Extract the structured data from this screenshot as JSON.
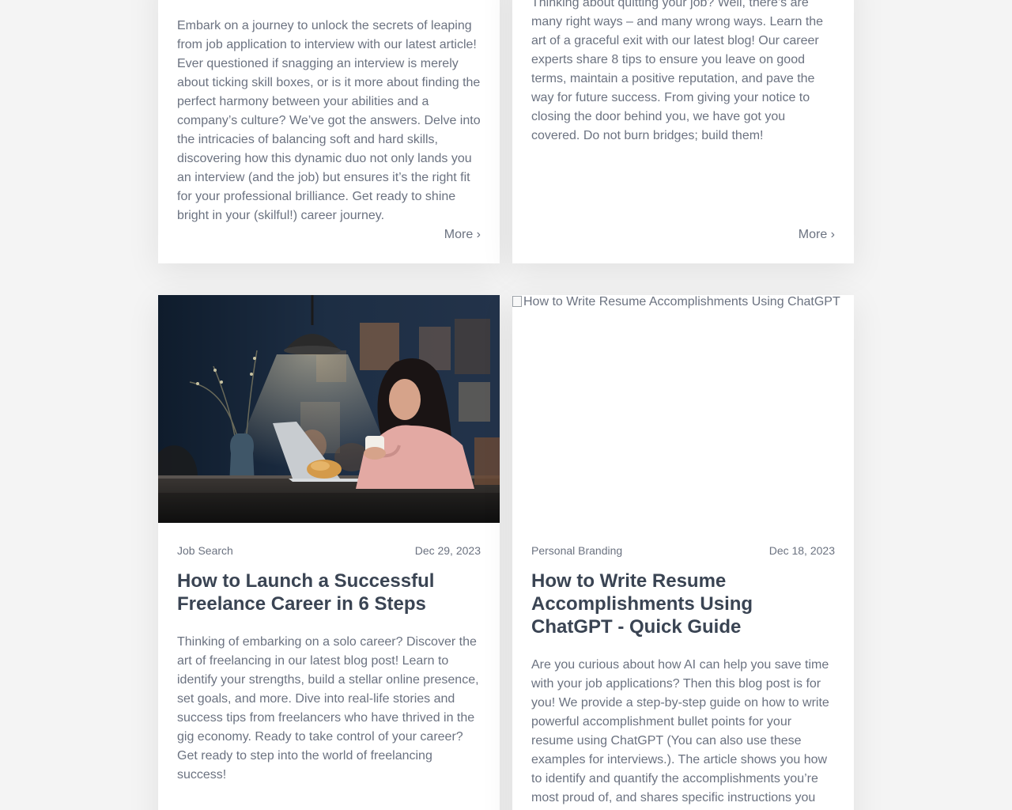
{
  "cards": {
    "top_left": {
      "excerpt": "Embark on a journey to unlock the secrets of leaping from job application to interview with our latest article! Ever questioned if snagging an interview is merely about ticking skill boxes, or is it more about finding the perfect harmony between your abilities and a company’s culture? We’ve got the answers. Delve into the intricacies of balancing soft and hard skills, discovering how this dynamic duo not only lands you an interview (and the job) but ensures it’s the right fit for your professional brilliance. Get ready to shine bright in your (skilful!) career journey.",
      "more_label": "More ›"
    },
    "top_right": {
      "excerpt": "Thinking about quitting your job? Well, there’s are many right ways – and many wrong ways. Learn the art of a graceful exit with our latest blog! Our career experts share 8 tips to ensure you leave on good terms, maintain a positive reputation, and pave the way for future success. From giving your notice to closing the door behind you, we have got you covered. Do not burn bridges; build them!",
      "more_label": "More ›"
    },
    "bottom_left": {
      "category": "Job Search",
      "date": "Dec 29, 2023",
      "title": "How to Launch a Successful Freelance Career in 6 Steps",
      "excerpt": "Thinking of embarking on a solo career? Discover the art of freelancing in our latest blog post! Learn to identify your strengths, build a stellar online presence, set goals, and more. Dive into real-life stories and success tips from freelancers who have thrived in the gig economy. Ready to take control of your career? Get ready to step into the world of freelancing success!"
    },
    "bottom_right": {
      "image_alt": "How to Write Resume Accomplishments Using ChatGPT",
      "category": "Personal Branding",
      "date": "Dec 18, 2023",
      "title": "How to Write Resume Accomplishments Using ChatGPT - Quick Guide",
      "excerpt": "Are you curious about how AI can help you save time with your job applications? Then this blog post is for you! We provide a step-by-step guide on how to write powerful accomplishment bullet points for your resume using ChatGPT (You can also use these examples for interviews.). The article shows you how to identify and quantify the accomplishments you’re most proud of, and shares specific instructions you can give ChatGPT to turn your notes into polished"
    }
  }
}
